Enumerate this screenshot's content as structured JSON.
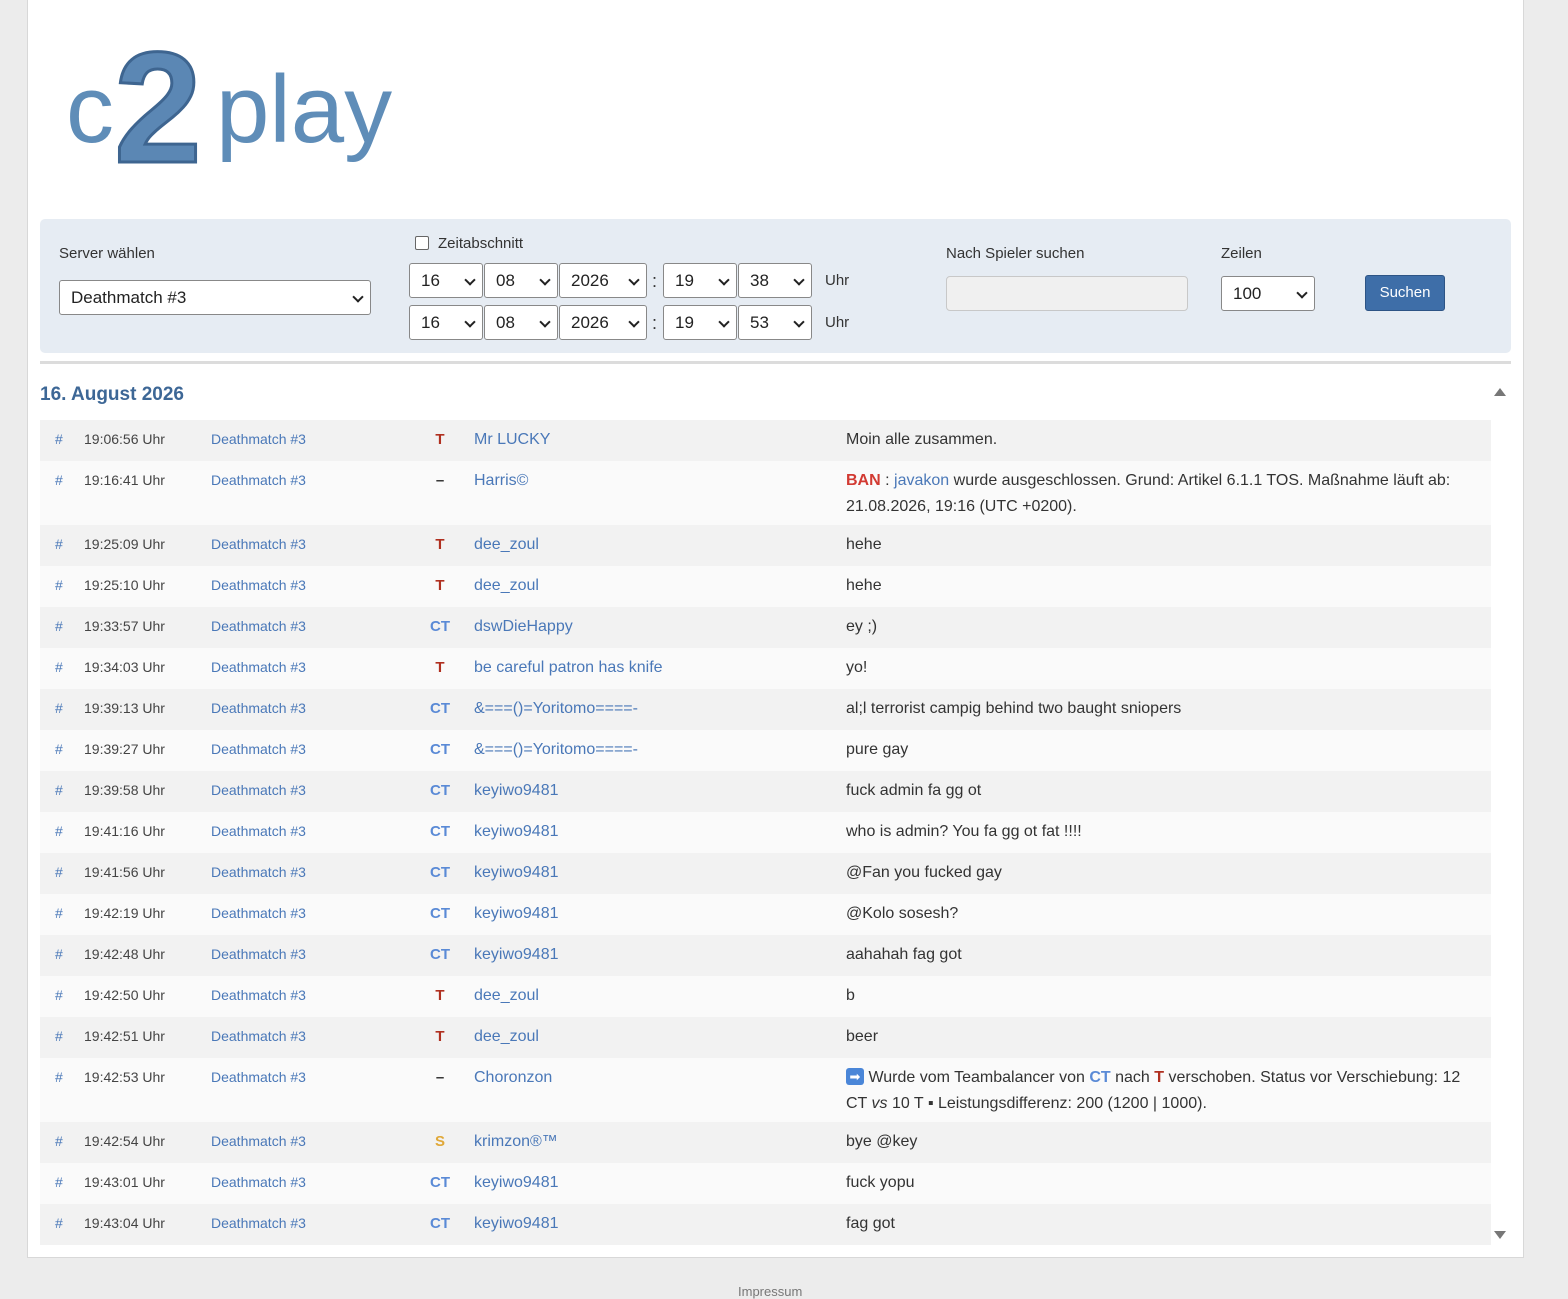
{
  "brand": {
    "logo_text": "c2play",
    "colors": {
      "logo": "#5f8db8",
      "accent": "#3e6ea8",
      "team_t": "#b03020",
      "team_ct": "#5a8ad6",
      "team_s": "#e0a838",
      "ban": "#d23a32"
    }
  },
  "filter": {
    "server_label": "Server wählen",
    "server_selected": "Deathmatch #3",
    "zeitabschnitt_label": "Zeitabschnitt",
    "zeitabschnitt_checked": false,
    "from": {
      "day": "16",
      "month": "08",
      "year": "2026",
      "hour": "19",
      "minute": "38",
      "unit": "Uhr"
    },
    "to": {
      "day": "16",
      "month": "08",
      "year": "2026",
      "hour": "19",
      "minute": "53",
      "unit": "Uhr"
    },
    "time_separator": ":",
    "player_search_label": "Nach Spieler suchen",
    "player_search_value": "",
    "rows_label": "Zeilen",
    "rows_selected": "100",
    "search_button": "Suchen"
  },
  "log": {
    "date_heading": "16. August 2026",
    "rows": [
      {
        "hash": "#",
        "time": "19:06:56 Uhr",
        "server": "Deathmatch #3",
        "team": "T",
        "player": "Mr LUCKY",
        "message": "Moin alle zusammen."
      },
      {
        "hash": "#",
        "time": "19:16:41 Uhr",
        "server": "Deathmatch #3",
        "team": "–",
        "player": "Harris©",
        "message": "",
        "ban": {
          "tag": "BAN",
          "sep": ":",
          "target": "javakon",
          "text": "wurde ausgeschlossen. Grund: Artikel 6.1.1 TOS. Maßnahme läuft ab: 21.08.2026, 19:16 (UTC +0200)."
        }
      },
      {
        "hash": "#",
        "time": "19:25:09 Uhr",
        "server": "Deathmatch #3",
        "team": "T",
        "player": "dee_zoul",
        "message": "hehe"
      },
      {
        "hash": "#",
        "time": "19:25:10 Uhr",
        "server": "Deathmatch #3",
        "team": "T",
        "player": "dee_zoul",
        "message": "hehe"
      },
      {
        "hash": "#",
        "time": "19:33:57 Uhr",
        "server": "Deathmatch #3",
        "team": "CT",
        "player": "dswDieHappy",
        "message": "ey ;)"
      },
      {
        "hash": "#",
        "time": "19:34:03 Uhr",
        "server": "Deathmatch #3",
        "team": "T",
        "player": "be careful patron has knife",
        "message": "yo!"
      },
      {
        "hash": "#",
        "time": "19:39:13 Uhr",
        "server": "Deathmatch #3",
        "team": "CT",
        "player": "&===()=Yoritomo====-",
        "message": "al;l terrorist campig behind two baught sniopers"
      },
      {
        "hash": "#",
        "time": "19:39:27 Uhr",
        "server": "Deathmatch #3",
        "team": "CT",
        "player": "&===()=Yoritomo====-",
        "message": "pure gay"
      },
      {
        "hash": "#",
        "time": "19:39:58 Uhr",
        "server": "Deathmatch #3",
        "team": "CT",
        "player": "keyiwo9481",
        "message": "fuck admin fa gg ot"
      },
      {
        "hash": "#",
        "time": "19:41:16 Uhr",
        "server": "Deathmatch #3",
        "team": "CT",
        "player": "keyiwo9481",
        "message": "who is admin? You fa gg ot fat !!!!"
      },
      {
        "hash": "#",
        "time": "19:41:56 Uhr",
        "server": "Deathmatch #3",
        "team": "CT",
        "player": "keyiwo9481",
        "message": "@Fan you fucked gay"
      },
      {
        "hash": "#",
        "time": "19:42:19 Uhr",
        "server": "Deathmatch #3",
        "team": "CT",
        "player": "keyiwo9481",
        "message": "@Kolo sosesh?"
      },
      {
        "hash": "#",
        "time": "19:42:48 Uhr",
        "server": "Deathmatch #3",
        "team": "CT",
        "player": "keyiwo9481",
        "message": "aahahah fag got"
      },
      {
        "hash": "#",
        "time": "19:42:50 Uhr",
        "server": "Deathmatch #3",
        "team": "T",
        "player": "dee_zoul",
        "message": "b"
      },
      {
        "hash": "#",
        "time": "19:42:51 Uhr",
        "server": "Deathmatch #3",
        "team": "T",
        "player": "dee_zoul",
        "message": "beer"
      },
      {
        "hash": "#",
        "time": "19:42:53 Uhr",
        "server": "Deathmatch #3",
        "team": "–",
        "player": "Choronzon",
        "message": "",
        "balancer": {
          "icon": "➡",
          "p1": "Wurde vom Teambalancer von",
          "from": "CT",
          "p2": "nach",
          "to": "T",
          "p3": "verschoben. Status vor Verschiebung:",
          "p4": "12 CT",
          "vs": "vs",
          "p5": "10 T ▪ Leistungsdifferenz: 200 (1200 | 1000)."
        }
      },
      {
        "hash": "#",
        "time": "19:42:54 Uhr",
        "server": "Deathmatch #3",
        "team": "S",
        "player": "krimzon®™",
        "message": "bye @key"
      },
      {
        "hash": "#",
        "time": "19:43:01 Uhr",
        "server": "Deathmatch #3",
        "team": "CT",
        "player": "keyiwo9481",
        "message": "fuck yopu"
      },
      {
        "hash": "#",
        "time": "19:43:04 Uhr",
        "server": "Deathmatch #3",
        "team": "CT",
        "player": "keyiwo9481",
        "message": "fag got"
      }
    ]
  },
  "footer": {
    "impressum": "Impressum"
  }
}
